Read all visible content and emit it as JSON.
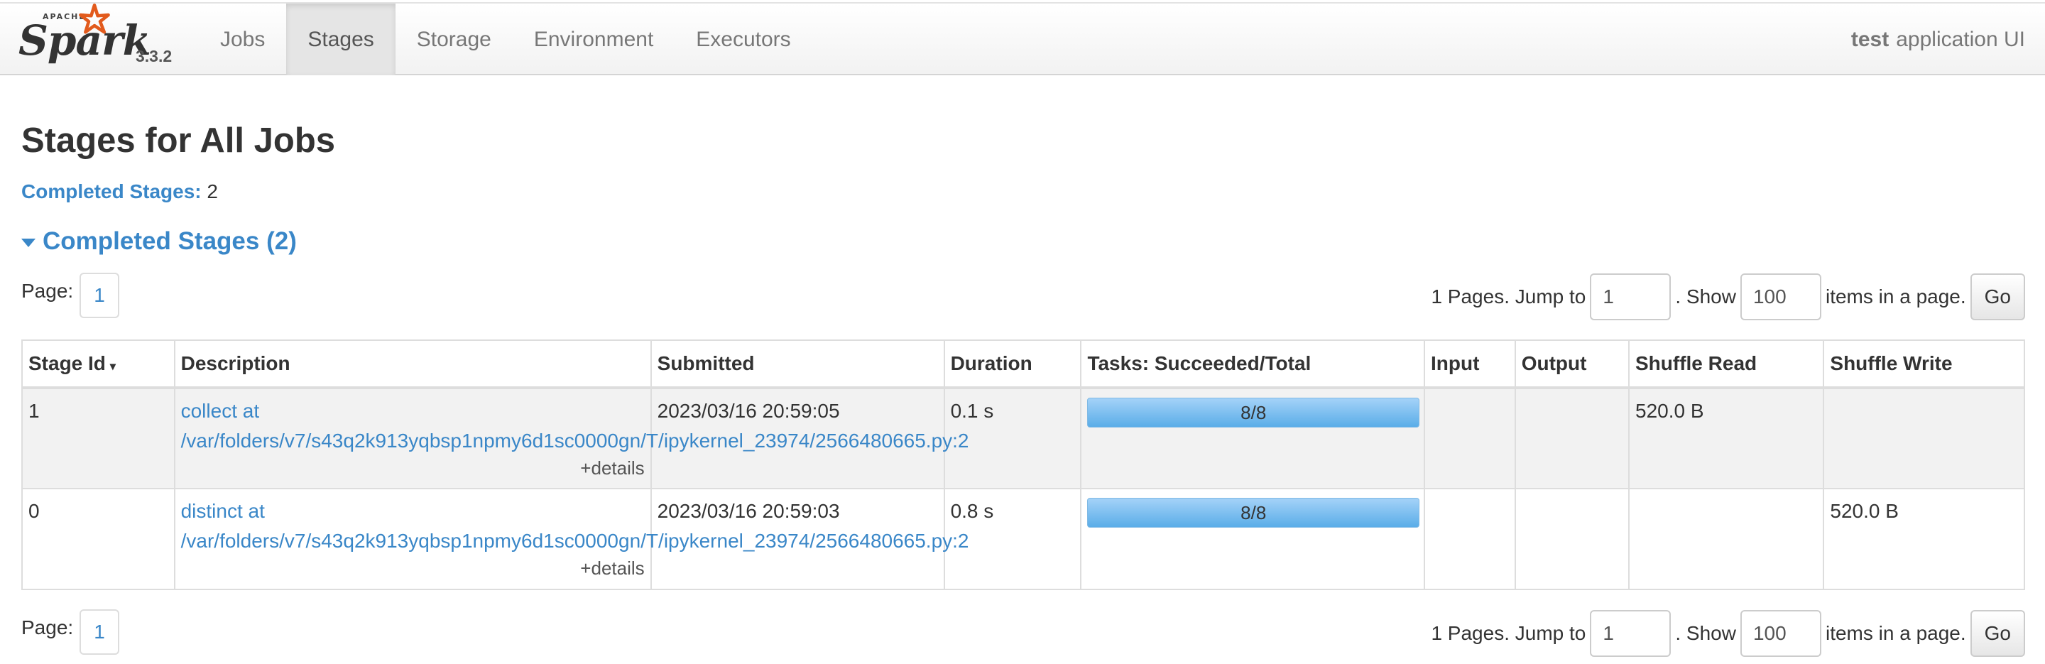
{
  "brand": {
    "apache": "APACHE",
    "name": "Spark",
    "version": "3.3.2"
  },
  "nav": {
    "tabs": [
      {
        "label": "Jobs"
      },
      {
        "label": "Stages"
      },
      {
        "label": "Storage"
      },
      {
        "label": "Environment"
      },
      {
        "label": "Executors"
      }
    ],
    "active": "Stages"
  },
  "app": {
    "name": "test",
    "suffix": "application UI"
  },
  "page": {
    "title": "Stages for All Jobs",
    "summary_label": "Completed Stages:",
    "summary_value": "2",
    "section_title": "Completed Stages (2)"
  },
  "pager": {
    "page_label": "Page:",
    "current_page": "1",
    "pages_text": "1 Pages. Jump to",
    "jump_value": "1",
    "show_text": ". Show",
    "show_value": "100",
    "items_text": "items in a page.",
    "go_label": "Go"
  },
  "table": {
    "headers": [
      "Stage Id",
      "Description",
      "Submitted",
      "Duration",
      "Tasks: Succeeded/Total",
      "Input",
      "Output",
      "Shuffle Read",
      "Shuffle Write"
    ],
    "sort_indicator": "▾",
    "details_label": "+details",
    "rows": [
      {
        "stage_id": "1",
        "desc_line1": "collect at",
        "desc_line2": "/var/folders/v7/s43q2k913yqbsp1npmy6d1sc0000gn/T/ipykernel_23974/2566480665.py:2",
        "submitted": "2023/03/16 20:59:05",
        "duration": "0.1 s",
        "tasks": "8/8",
        "tasks_fraction": 1.0,
        "input": "",
        "output": "",
        "shuffle_read": "520.0 B",
        "shuffle_write": ""
      },
      {
        "stage_id": "0",
        "desc_line1": "distinct at",
        "desc_line2": "/var/folders/v7/s43q2k913yqbsp1npmy6d1sc0000gn/T/ipykernel_23974/2566480665.py:2",
        "submitted": "2023/03/16 20:59:03",
        "duration": "0.8 s",
        "tasks": "8/8",
        "tasks_fraction": 1.0,
        "input": "",
        "output": "",
        "shuffle_read": "",
        "shuffle_write": "520.0 B"
      }
    ]
  },
  "colors": {
    "link": "#3a87c8",
    "progress": "#5aade8"
  }
}
